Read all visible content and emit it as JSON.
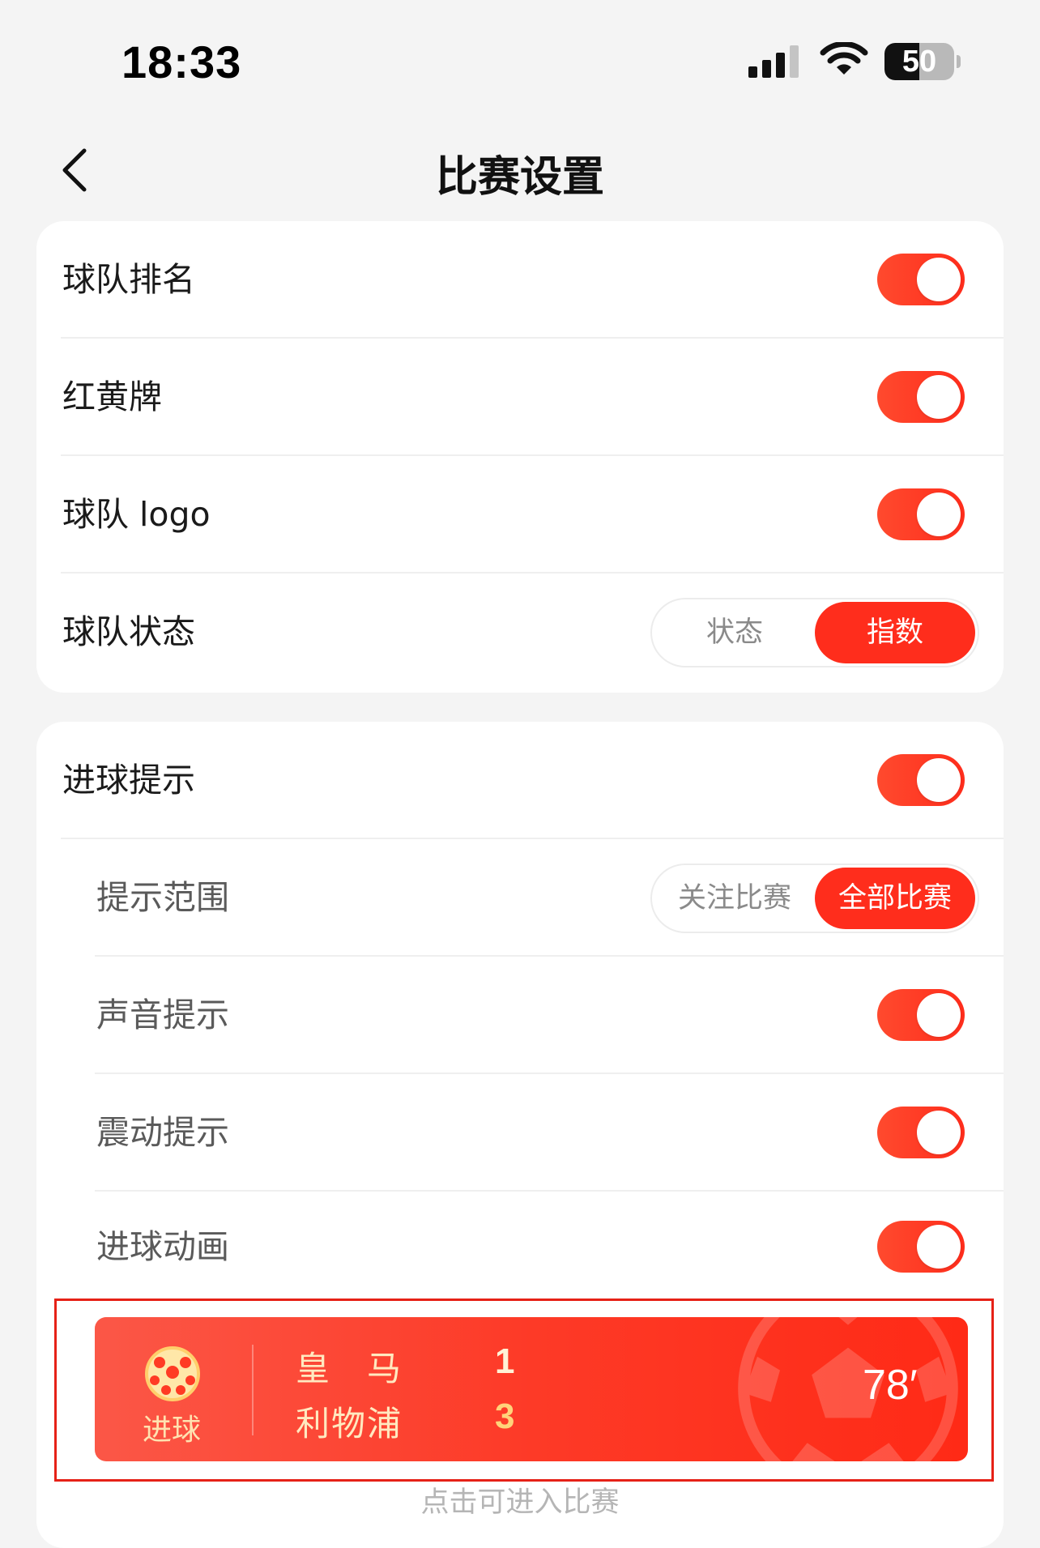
{
  "status_bar": {
    "time": "18:33",
    "battery_level": "50",
    "battery_fraction": 0.5
  },
  "header": {
    "title": "比赛设置",
    "back_icon": "chevron-left-icon"
  },
  "display_settings": {
    "team_ranking": {
      "label": "球队排名",
      "enabled": true
    },
    "cards": {
      "label": "红黄牌",
      "enabled": true
    },
    "team_logo": {
      "label": "球队 logo",
      "enabled": true
    },
    "team_status": {
      "label": "球队状态",
      "options": [
        "状态",
        "指数"
      ],
      "selected": "指数"
    }
  },
  "goal_settings": {
    "goal_alert": {
      "label": "进球提示",
      "enabled": true
    },
    "alert_scope": {
      "label": "提示范围",
      "options": [
        "关注比赛",
        "全部比赛"
      ],
      "selected": "全部比赛"
    },
    "sound_alert": {
      "label": "声音提示",
      "enabled": true
    },
    "vibration_alert": {
      "label": "震动提示",
      "enabled": true
    },
    "goal_animation": {
      "label": "进球动画",
      "enabled": true
    }
  },
  "goal_preview": {
    "badge_icon": "soccer-ball-icon",
    "badge_label": "进球",
    "home_team": "皇　马",
    "home_score": "1",
    "away_team": "利物浦",
    "away_score": "3",
    "minute": "78′",
    "hint": "点击可进入比赛"
  },
  "colors": {
    "accent": "#ff2d1c",
    "page_background": "#f4f4f4",
    "card_background": "#ffffff"
  }
}
